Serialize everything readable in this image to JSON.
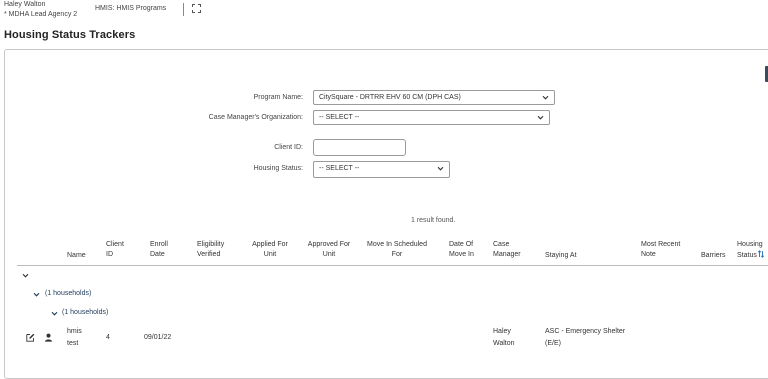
{
  "header": {
    "user_name": "Haley Walton",
    "user_agency": "* MDHA Lead Agency 2",
    "module": "HMIS: HMIS Programs"
  },
  "page": {
    "title": "Housing Status Trackers"
  },
  "filters": {
    "program_name_label": "Program Name:",
    "program_name_value": "CitySquare - DRTRR EHV 60 CM (DPH CAS)",
    "case_manager_org_label": "Case Manager's Organization:",
    "case_manager_org_value": "-- SELECT --",
    "client_id_label": "Client ID:",
    "client_id_value": "",
    "housing_status_label": "Housing Status:",
    "housing_status_value": "-- SELECT --"
  },
  "results": {
    "summary": "1 result found."
  },
  "table": {
    "headers": {
      "name": "Name",
      "client_id": [
        "Client",
        "ID"
      ],
      "enroll_date": [
        "Enroll",
        "Date"
      ],
      "eligibility": [
        "Eligibility",
        "Verified"
      ],
      "applied": [
        "Applied For",
        "Unit"
      ],
      "approved": [
        "Approved For",
        "Unit"
      ],
      "move_in_scheduled": [
        "Move In Scheduled",
        "For"
      ],
      "date_move_in": [
        "Date Of",
        "Move In"
      ],
      "case_manager": [
        "Case",
        "Manager"
      ],
      "staying_at": "Staying At",
      "most_recent_note": [
        "Most Recent",
        "Note"
      ],
      "barriers": "Barriers",
      "housing_status": [
        "Housing",
        "Status"
      ]
    },
    "groups": {
      "level1": "(1 households)",
      "level2": "(1 households)"
    },
    "rows": [
      {
        "name": [
          "hmis",
          "test"
        ],
        "client_id": "4",
        "enroll_date": "09/01/22",
        "case_manager": [
          "Haley",
          "Walton"
        ],
        "staying_at": [
          "ASC - Emergency Shelter",
          "(E/E)"
        ]
      }
    ]
  },
  "icons": {
    "expand": "expand-icon",
    "chevron": "chevron-down-icon",
    "edit": "edit-icon",
    "person": "person-icon",
    "sort": "sort-icon"
  },
  "colors": {
    "sort_accent": "#2a6ebb",
    "group_text": "#1f3b5c",
    "panel_strip": "#3c4a5c"
  }
}
